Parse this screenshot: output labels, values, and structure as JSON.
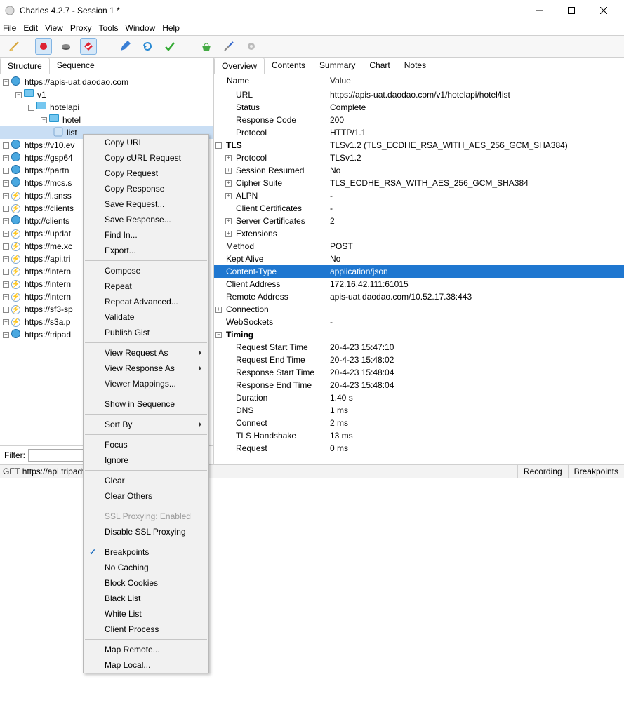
{
  "window": {
    "title": "Charles 4.2.7 - Session 1 *"
  },
  "menus": [
    "File",
    "Edit",
    "View",
    "Proxy",
    "Tools",
    "Window",
    "Help"
  ],
  "left_tabs": [
    "Structure",
    "Sequence"
  ],
  "left_tab_active": "Structure",
  "tree": {
    "root_host": "https://apis-uat.daodao.com",
    "p1": "v1",
    "p2": "hotelapi",
    "p3": "hotel",
    "p4": "list",
    "hosts": [
      {
        "t": "globe",
        "l": "https://v10.ev"
      },
      {
        "t": "globe",
        "l": "https://gsp64"
      },
      {
        "t": "globe",
        "l": "https://partn"
      },
      {
        "t": "globe",
        "l": "https://mcs.s"
      },
      {
        "t": "bolt",
        "l": "https://i.snss"
      },
      {
        "t": "bolt",
        "l": "https://clients"
      },
      {
        "t": "globe",
        "l": "http://clients"
      },
      {
        "t": "bolt",
        "l": "https://updat"
      },
      {
        "t": "bolt",
        "l": "https://me.xc"
      },
      {
        "t": "bolt",
        "l": "https://api.tri"
      },
      {
        "t": "bolt",
        "l": "https://intern"
      },
      {
        "t": "bolt",
        "l": "https://intern"
      },
      {
        "t": "bolt",
        "l": "https://intern"
      },
      {
        "t": "bolt",
        "l": "https://sf3-sp"
      },
      {
        "t": "bolt",
        "l": "https://s3a.p"
      },
      {
        "t": "globe",
        "l": "https://tripad"
      }
    ]
  },
  "filter_label": "Filter:",
  "right_tabs": [
    "Overview",
    "Contents",
    "Summary",
    "Chart",
    "Notes"
  ],
  "right_tab_active": "Overview",
  "ov_head": {
    "name": "Name",
    "value": "Value"
  },
  "overview": [
    {
      "k": "URL",
      "v": "https://apis-uat.daodao.com/v1/hotelapi/hotel/list",
      "i": 2
    },
    {
      "k": "Status",
      "v": "Complete",
      "i": 2
    },
    {
      "k": "Response Code",
      "v": "200",
      "i": 2
    },
    {
      "k": "Protocol",
      "v": "HTTP/1.1",
      "i": 2
    },
    {
      "k": "TLS",
      "v": "TLSv1.2 (TLS_ECDHE_RSA_WITH_AES_256_GCM_SHA384)",
      "i": 1,
      "pm": "-",
      "bold": true
    },
    {
      "k": "Protocol",
      "v": "TLSv1.2",
      "i": 2,
      "pm": "+"
    },
    {
      "k": "Session Resumed",
      "v": "No",
      "i": 2,
      "pm": "+"
    },
    {
      "k": "Cipher Suite",
      "v": "TLS_ECDHE_RSA_WITH_AES_256_GCM_SHA384",
      "i": 2,
      "pm": "+"
    },
    {
      "k": "ALPN",
      "v": "-",
      "i": 2,
      "pm": "+"
    },
    {
      "k": "Client Certificates",
      "v": "-",
      "i": 2
    },
    {
      "k": "Server Certificates",
      "v": "2",
      "i": 2,
      "pm": "+"
    },
    {
      "k": "Extensions",
      "v": "",
      "i": 2,
      "pm": "+"
    },
    {
      "k": "Method",
      "v": "POST",
      "i": 2,
      "up": true
    },
    {
      "k": "Kept Alive",
      "v": "No",
      "i": 2,
      "up": true
    },
    {
      "k": "Content-Type",
      "v": "application/json",
      "i": 2,
      "up": true,
      "sel": true
    },
    {
      "k": "Client Address",
      "v": "172.16.42.111:61015",
      "i": 2,
      "up": true
    },
    {
      "k": "Remote Address",
      "v": "apis-uat.daodao.com/10.52.17.38:443",
      "i": 2,
      "up": true
    },
    {
      "k": "Connection",
      "v": "",
      "i": 1,
      "pm": "+"
    },
    {
      "k": "WebSockets",
      "v": "-",
      "i": 2,
      "up": true
    },
    {
      "k": "Timing",
      "v": "",
      "i": 1,
      "pm": "-",
      "bold": true
    },
    {
      "k": "Request Start Time",
      "v": "20-4-23 15:47:10",
      "i": 2
    },
    {
      "k": "Request End Time",
      "v": "20-4-23 15:48:02",
      "i": 2
    },
    {
      "k": "Response Start Time",
      "v": "20-4-23 15:48:04",
      "i": 2
    },
    {
      "k": "Response End Time",
      "v": "20-4-23 15:48:04",
      "i": 2
    },
    {
      "k": "Duration",
      "v": "1.40 s",
      "i": 2
    },
    {
      "k": "DNS",
      "v": "1 ms",
      "i": 2
    },
    {
      "k": "Connect",
      "v": "2 ms",
      "i": 2
    },
    {
      "k": "TLS Handshake",
      "v": "13 ms",
      "i": 2
    },
    {
      "k": "Request",
      "v": "0 ms",
      "i": 2
    }
  ],
  "status": {
    "left": "GET https://api.tripadvi",
    "rec": "Recording",
    "bp": "Breakpoints"
  },
  "context_menu": [
    {
      "l": "Copy URL"
    },
    {
      "l": "Copy cURL Request"
    },
    {
      "l": "Copy Request"
    },
    {
      "l": "Copy Response"
    },
    {
      "l": "Save Request..."
    },
    {
      "l": "Save Response..."
    },
    {
      "l": "Find In..."
    },
    {
      "l": "Export..."
    },
    {
      "sep": true
    },
    {
      "l": "Compose"
    },
    {
      "l": "Repeat"
    },
    {
      "l": "Repeat Advanced..."
    },
    {
      "l": "Validate"
    },
    {
      "l": "Publish Gist"
    },
    {
      "sep": true
    },
    {
      "l": "View Request As",
      "sub": true
    },
    {
      "l": "View Response As",
      "sub": true
    },
    {
      "l": "Viewer Mappings..."
    },
    {
      "sep": true
    },
    {
      "l": "Show in Sequence"
    },
    {
      "sep": true
    },
    {
      "l": "Sort By",
      "sub": true
    },
    {
      "sep": true
    },
    {
      "l": "Focus"
    },
    {
      "l": "Ignore"
    },
    {
      "sep": true
    },
    {
      "l": "Clear"
    },
    {
      "l": "Clear Others"
    },
    {
      "sep": true
    },
    {
      "l": "SSL Proxying: Enabled",
      "disabled": true
    },
    {
      "l": "Disable SSL Proxying"
    },
    {
      "sep": true
    },
    {
      "l": "Breakpoints",
      "chk": true
    },
    {
      "l": "No Caching"
    },
    {
      "l": "Block Cookies"
    },
    {
      "l": "Black List"
    },
    {
      "l": "White List"
    },
    {
      "l": "Client Process"
    },
    {
      "sep": true
    },
    {
      "l": "Map Remote..."
    },
    {
      "l": "Map Local..."
    }
  ]
}
